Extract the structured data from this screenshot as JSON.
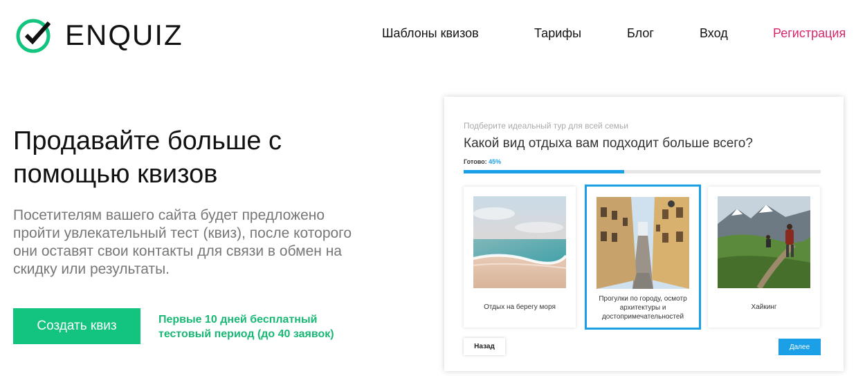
{
  "header": {
    "brand": "ENQUIZ",
    "nav": [
      {
        "label": "Шаблоны квизов"
      },
      {
        "label": "Тарифы"
      },
      {
        "label": "Блог"
      },
      {
        "label": "Вход"
      },
      {
        "label": "Регистрация"
      }
    ]
  },
  "hero": {
    "title": "Продавайте больше с помощью квизов",
    "description": "Посетителям вашего сайта будет предложено пройти увлекательный тест (квиз), после которого они оставят свои контакты для связи в обмен на скидку или результаты.",
    "cta_label": "Создать квиз",
    "trial_note": "Первые 10 дней бесплатный тестовый период (до 40 заявок)"
  },
  "quiz": {
    "subtitle": "Подберите идеальный тур для всей семьи",
    "question": "Какой вид отдыха вам подходит больше всего?",
    "progress_label": "Готово:",
    "progress_text": "45%",
    "progress_value": 0.45,
    "options": [
      {
        "label": "Отдых на берегу моря",
        "image": "beach-image",
        "selected": false
      },
      {
        "label": "Прогулки по городу, осмотр архитектуры и достопримечательностей",
        "image": "old-town-street-image",
        "selected": true
      },
      {
        "label": "Хайкинг",
        "image": "hiking-image",
        "selected": false
      }
    ],
    "back_label": "Назад",
    "next_label": "Далее"
  },
  "colors": {
    "brand_green": "#12c47e",
    "accent_pink": "#d8256b",
    "accent_blue": "#1b9fe6"
  }
}
